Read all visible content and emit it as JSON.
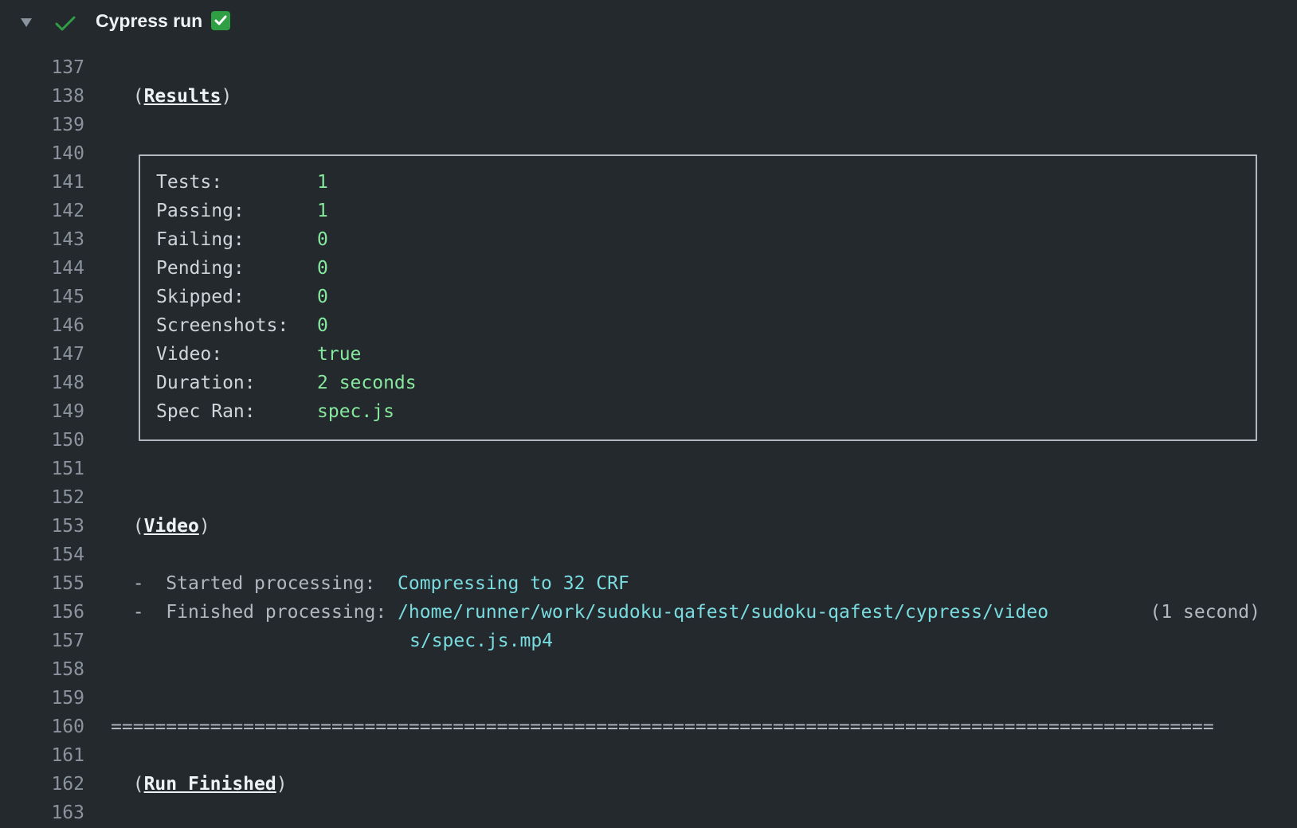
{
  "step": {
    "title": "Cypress run",
    "status_icon": "check-icon",
    "emoji": "white-check-mark"
  },
  "lines": {
    "n137": "137",
    "n138": "138",
    "n139": "139",
    "n140": "140",
    "n141": "141",
    "n142": "142",
    "n143": "143",
    "n144": "144",
    "n145": "145",
    "n146": "146",
    "n147": "147",
    "n148": "148",
    "n149": "149",
    "n150": "150",
    "n151": "151",
    "n152": "152",
    "n153": "153",
    "n154": "154",
    "n155": "155",
    "n156": "156",
    "n157": "157",
    "n158": "158",
    "n159": "159",
    "n160": "160",
    "n161": "161",
    "n162": "162",
    "n163": "163"
  },
  "sections": {
    "results": "Results",
    "video": "Video",
    "run_finished": "Run Finished"
  },
  "results": [
    {
      "label": "Tests:",
      "value": "1"
    },
    {
      "label": "Passing:",
      "value": "1"
    },
    {
      "label": "Failing:",
      "value": "0"
    },
    {
      "label": "Pending:",
      "value": "0"
    },
    {
      "label": "Skipped:",
      "value": "0"
    },
    {
      "label": "Screenshots:",
      "value": "0"
    },
    {
      "label": "Video:",
      "value": "true"
    },
    {
      "label": "Duration:",
      "value": "2 seconds"
    },
    {
      "label": "Spec Ran:",
      "value": "spec.js"
    }
  ],
  "video": {
    "started_label": "-  Started processing:",
    "started_value": "Compressing to 32 CRF",
    "finished_label": "-  Finished processing:",
    "finished_value_1": "/home/runner/work/sudoku-qafest/sudoku-qafest/cypress/video",
    "finished_value_2": "s/spec.js.mp4",
    "finished_duration": "(1 second)"
  },
  "separator": "====================================================================================================",
  "colors": {
    "background": "#24292e",
    "success": "#2ea043",
    "value_green": "#85e89d",
    "value_cyan": "#79dcdf"
  }
}
